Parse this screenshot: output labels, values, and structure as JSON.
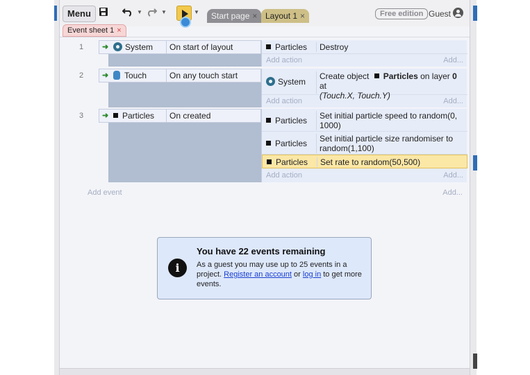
{
  "toolbar": {
    "menu_label": "Menu",
    "save_icon": "floppy-disk-icon",
    "undo_icon": "undo-icon",
    "redo_icon": "redo-icon",
    "play_icon": "play-preview-icon",
    "tabs": [
      {
        "label": "Start page",
        "close": "×"
      },
      {
        "label": "Layout 1",
        "close": "×"
      }
    ],
    "edition_badge": "Free edition",
    "user_label": "Guest",
    "user_icon": "user-account-icon"
  },
  "sheet_tab": {
    "label": "Event sheet 1",
    "close": "×"
  },
  "events": [
    {
      "number": "1",
      "condition": {
        "object": "System",
        "object_icon": "gear-icon",
        "text": "On start of layout"
      },
      "actions": [
        {
          "object": "Particles",
          "text": "Destroy"
        }
      ]
    },
    {
      "number": "2",
      "condition": {
        "object": "Touch",
        "object_icon": "hand-icon",
        "text": "On any touch start"
      },
      "actions": [
        {
          "object": "System",
          "text_prefix": "Create object",
          "object_name": "Particles",
          "text_mid": "on layer",
          "layer": "0",
          "text_at": "at",
          "coords": "(Touch.X, Touch.Y)"
        }
      ]
    },
    {
      "number": "3",
      "condition": {
        "object": "Particles",
        "object_icon": "particles-icon",
        "text": "On created"
      },
      "actions": [
        {
          "object": "Particles",
          "text": "Set initial particle speed to random(0, 1000)"
        },
        {
          "object": "Particles",
          "text": "Set initial particle size randomiser to random(1,100)"
        },
        {
          "object": "Particles",
          "text": "Set rate to random(50,500)",
          "selected": true
        }
      ]
    }
  ],
  "add_action_label": "Add action",
  "add_right_label": "Add...",
  "add_event_label": "Add event",
  "notice": {
    "title": "You have 22 events remaining",
    "text_before": "As a guest you may use up to 25 events in a project.",
    "register_link": "Register an account",
    "or": "or",
    "login_link": "log in",
    "text_after": "to get more events.",
    "icon": "info-icon"
  },
  "colors": {
    "accent_play": "#f2c94c",
    "selected_row": "#fbe7a6",
    "condition_block": "#b1bdd0",
    "actions_bg": "#e6ecf8",
    "notice_bg": "#dde8fb",
    "sheet_tab": "#f7d6d6",
    "link": "#1a3fcf"
  }
}
